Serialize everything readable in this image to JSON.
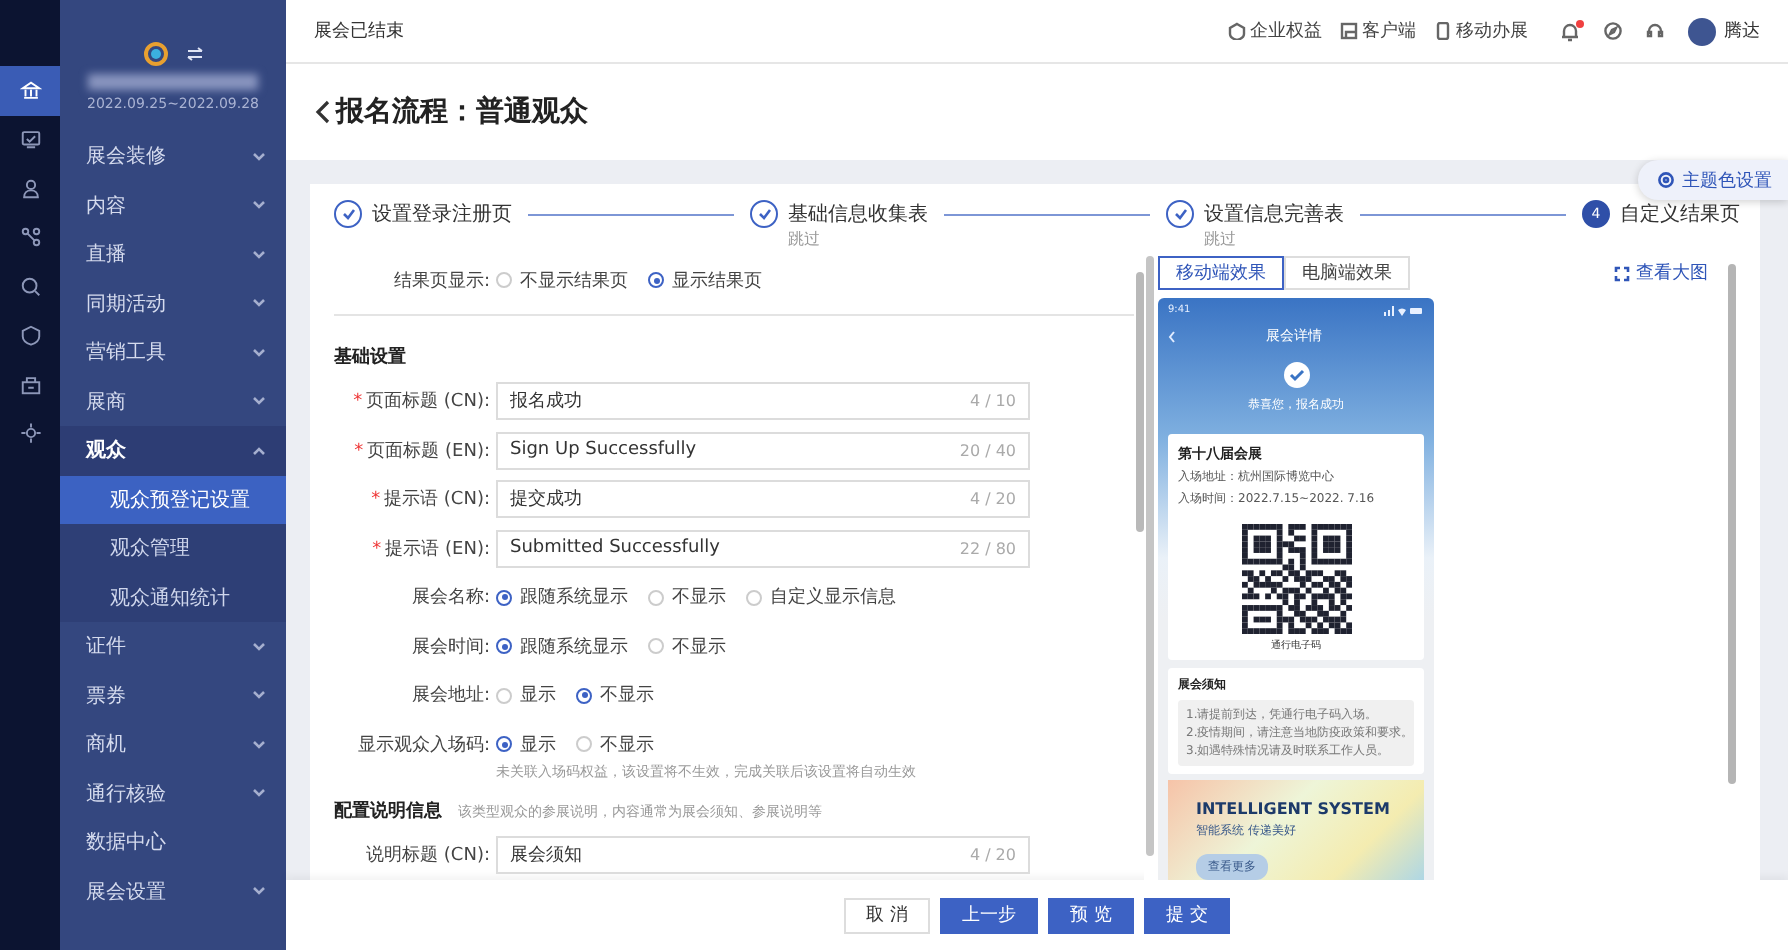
{
  "rail": {
    "items": [
      {
        "selected": true
      },
      {
        "selected": false
      },
      {
        "selected": false
      },
      {
        "selected": false
      },
      {
        "selected": false
      },
      {
        "selected": false
      },
      {
        "selected": false
      },
      {
        "selected": false
      }
    ]
  },
  "sidebar": {
    "date_range": "2022.09.25~2022.09.28",
    "items": [
      {
        "label": "展会装修",
        "kind": "group",
        "expanded": false
      },
      {
        "label": "内容",
        "kind": "group",
        "expanded": false
      },
      {
        "label": "直播",
        "kind": "group",
        "expanded": false
      },
      {
        "label": "同期活动",
        "kind": "group",
        "expanded": false
      },
      {
        "label": "营销工具",
        "kind": "group",
        "expanded": false
      },
      {
        "label": "展商",
        "kind": "group",
        "expanded": false
      },
      {
        "label": "观众",
        "kind": "group",
        "expanded": true,
        "children": [
          {
            "label": "观众预登记设置",
            "selected": true
          },
          {
            "label": "观众管理",
            "selected": false
          },
          {
            "label": "观众通知统计",
            "selected": false
          }
        ]
      },
      {
        "label": "证件",
        "kind": "group",
        "expanded": false
      },
      {
        "label": "票券",
        "kind": "group",
        "expanded": false
      },
      {
        "label": "商机",
        "kind": "group",
        "expanded": false
      },
      {
        "label": "通行核验",
        "kind": "group",
        "expanded": false
      },
      {
        "label": "数据中心",
        "kind": "link"
      },
      {
        "label": "展会设置",
        "kind": "group",
        "expanded": false
      }
    ]
  },
  "top_bar": {
    "status": "展会已结束",
    "links": [
      "企业权益",
      "客户端",
      "移动办展"
    ],
    "notifications_unread": true,
    "user_name": "腾达"
  },
  "page_title": "报名流程：普通观众",
  "theme_button": "主题色设置",
  "steps": [
    {
      "label": "设置登录注册页",
      "done": true
    },
    {
      "label": "基础信息收集表",
      "done": true,
      "note": "跳过"
    },
    {
      "label": "设置信息完善表",
      "done": true,
      "note": "跳过"
    },
    {
      "label": "自定义结果页",
      "done": false,
      "number": "4"
    }
  ],
  "form": {
    "result_display": {
      "label": "结果页显示:",
      "options": [
        {
          "label": "不显示结果页",
          "selected": false
        },
        {
          "label": "显示结果页",
          "selected": true
        }
      ]
    },
    "basic_title": "基础设置",
    "fields": [
      {
        "label": "页面标题 (CN):",
        "required_mark": "*",
        "value": "报名成功",
        "count": "4 / 10"
      },
      {
        "label": "页面标题 (EN):",
        "required_mark": "*",
        "value": "Sign Up Successfully",
        "count": "20 / 40"
      },
      {
        "label": "提示语 (CN):",
        "required_mark": "*",
        "value": "提交成功",
        "count": "4 / 20"
      },
      {
        "label": "提示语 (EN):",
        "required_mark": "*",
        "value": "Submitted Successfully",
        "count": "22 / 80"
      }
    ],
    "radio_rows": [
      {
        "label": "展会名称:",
        "options": [
          {
            "label": "跟随系统显示",
            "selected": true
          },
          {
            "label": "不显示",
            "selected": false
          },
          {
            "label": "自定义显示信息",
            "selected": false
          }
        ]
      },
      {
        "label": "展会时间:",
        "options": [
          {
            "label": "跟随系统显示",
            "selected": true
          },
          {
            "label": "不显示",
            "selected": false
          }
        ]
      },
      {
        "label": "展会地址:",
        "options": [
          {
            "label": "显示",
            "selected": false
          },
          {
            "label": "不显示",
            "selected": true
          }
        ]
      },
      {
        "label": "显示观众入场码:",
        "options": [
          {
            "label": "显示",
            "selected": true
          },
          {
            "label": "不显示",
            "selected": false
          }
        ],
        "hint": "未关联入场码权益，该设置将不生效，完成关联后该设置将自动生效"
      }
    ],
    "info_title": "配置说明信息",
    "info_hint": "该类型观众的参展说明，内容通常为展会须知、参展说明等",
    "info_fields": [
      {
        "label": "说明标题 (CN):",
        "value": "展会须知",
        "count": "4 / 20"
      }
    ]
  },
  "preview": {
    "tabs": [
      {
        "label": "移动端效果",
        "selected": true
      },
      {
        "label": "电脑端效果",
        "selected": false
      }
    ],
    "enlarge": "查看大图",
    "phone": {
      "time": "9:41",
      "title": "展会详情",
      "success": "恭喜您，报名成功",
      "event_name": "第十八届会展",
      "address": "入场地址：杭州国际博览中心",
      "time_range": "入场时间：2022.7.15~2022. 7.16",
      "qr_caption": "通行电子码",
      "notice_title": "展会须知",
      "notice_lines": [
        "1.请提前到达，凭通行电子码入场。",
        "2.疫情期间，请注意当地防疫政策和要求。",
        "3.如遇特殊情况请及时联系工作人员。"
      ],
      "banner_title": "INTELLIGENT SYSTEM",
      "banner_subtitle": "智能系统 传递美好",
      "banner_button": "查看更多"
    }
  },
  "footer_buttons": [
    {
      "label": "取 消",
      "kind": "secondary"
    },
    {
      "label": "上一步",
      "kind": "primary"
    },
    {
      "label": "预 览",
      "kind": "primary"
    },
    {
      "label": "提 交",
      "kind": "primary"
    }
  ]
}
